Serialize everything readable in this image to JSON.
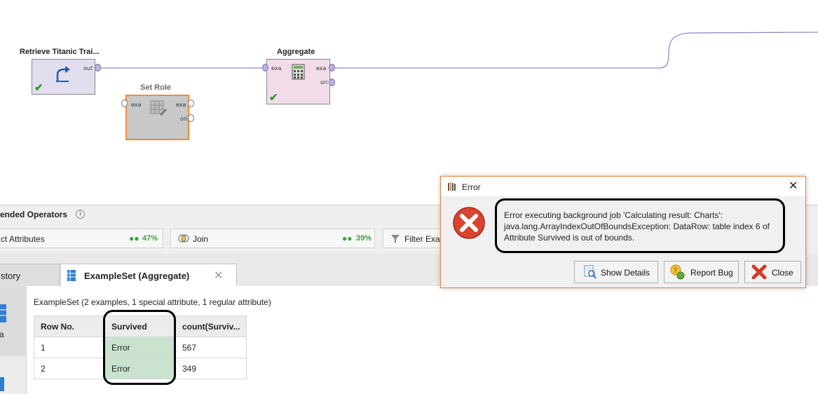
{
  "canvas": {
    "operators": {
      "retrieve": {
        "title": "Retrieve Titanic Trai...",
        "ports": {
          "out": "out"
        }
      },
      "set_role": {
        "title": "Set Role",
        "ports": {
          "in": "exa",
          "out": "exa",
          "ori": "ori"
        }
      },
      "aggregate": {
        "title": "Aggregate",
        "ports": {
          "in": "exa",
          "out": "exa",
          "ori": "ori"
        }
      }
    }
  },
  "recommended": {
    "header": "ended Operators",
    "cards": [
      {
        "label": "ct Attributes",
        "percent": "47%"
      },
      {
        "label": "Join",
        "percent": "39%"
      },
      {
        "label": "Filter Exa"
      }
    ]
  },
  "tabs": [
    {
      "label": "story"
    },
    {
      "label": "ExampleSet (Aggregate)"
    }
  ],
  "left_strip": {
    "label": "a"
  },
  "results": {
    "summary": "ExampleSet (2 examples, 1 special attribute, 1 regular attribute)",
    "columns": [
      "Row No.",
      "Survived",
      "count(Surviv..."
    ],
    "rows": [
      [
        "1",
        "Error",
        "567"
      ],
      [
        "2",
        "Error",
        "349"
      ]
    ]
  },
  "dialog": {
    "title": "Error",
    "message": "Error executing background job 'Calculating result: Charts': java.lang.ArrayIndexOutOfBoundsException: DataRow: table index 6 of Attribute Survived is out of bounds.",
    "buttons": {
      "show_details": "Show Details",
      "report_bug": "Report Bug",
      "close": "Close"
    }
  },
  "colors": {
    "accent_orange": "#e08a3e",
    "success_green": "#3da23d",
    "error_red": "#d9432f",
    "survived_cell": "#c9e3cf"
  }
}
